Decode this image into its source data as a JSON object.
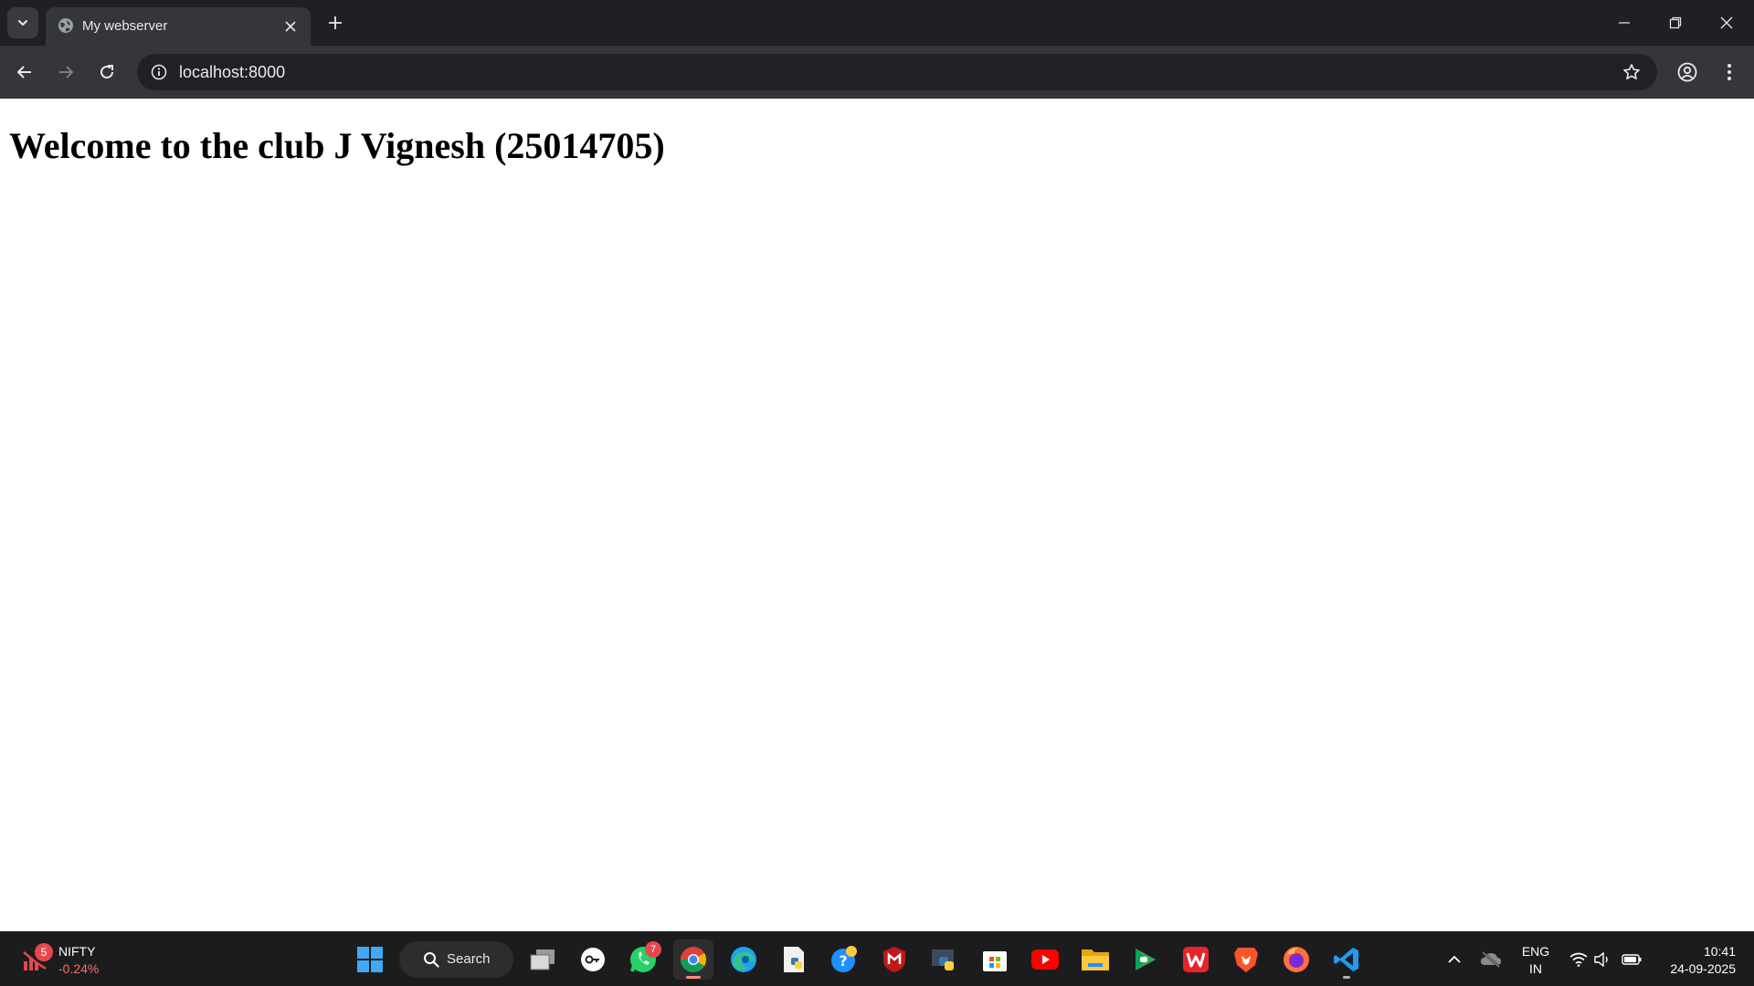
{
  "browser": {
    "tab": {
      "title": "My webserver"
    },
    "address_bar": {
      "url": "localhost:8000"
    }
  },
  "page": {
    "heading": "Welcome to the club J Vignesh (25014705)"
  },
  "taskbar": {
    "widget": {
      "badge": "5",
      "title": "NIFTY",
      "value": "-0.24%"
    },
    "search": {
      "label": "Search"
    },
    "apps": [
      {
        "name": "task-view",
        "icon": "task-view-icon"
      },
      {
        "name": "password-manager",
        "icon": "key-icon"
      },
      {
        "name": "whatsapp",
        "icon": "whatsapp-icon",
        "badge": "7"
      },
      {
        "name": "chrome",
        "icon": "chrome-icon",
        "active": true
      },
      {
        "name": "edge",
        "icon": "edge-icon"
      },
      {
        "name": "python-editor",
        "icon": "python-file-icon"
      },
      {
        "name": "get-help",
        "icon": "help-icon"
      },
      {
        "name": "mcafee",
        "icon": "mcafee-icon"
      },
      {
        "name": "python",
        "icon": "python-icon"
      },
      {
        "name": "microsoft-store",
        "icon": "store-icon"
      },
      {
        "name": "youtube",
        "icon": "youtube-icon"
      },
      {
        "name": "file-explorer",
        "icon": "folder-icon"
      },
      {
        "name": "play-games",
        "icon": "play-games-icon"
      },
      {
        "name": "wps-office",
        "icon": "wps-icon"
      },
      {
        "name": "brave",
        "icon": "brave-icon"
      },
      {
        "name": "firefox",
        "icon": "firefox-icon"
      },
      {
        "name": "vscode",
        "icon": "vscode-icon"
      }
    ],
    "tray": {
      "language": "ENG",
      "region": "IN",
      "time": "10:41",
      "date": "24-09-2025"
    }
  },
  "colors": {
    "tabstrip_bg": "#1f2023",
    "toolbar_bg": "#35363a",
    "omnibox_bg": "#202124",
    "taskbar_bg": "#1c1c1e",
    "widget_negative": "#ff6b6b",
    "badge_red": "#e5484d"
  }
}
